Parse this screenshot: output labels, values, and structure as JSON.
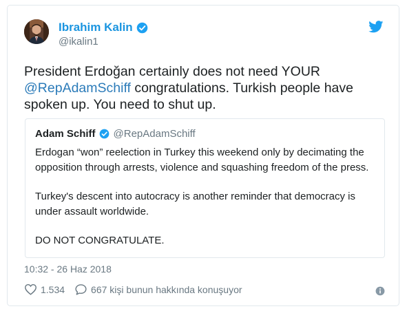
{
  "tweet": {
    "author": {
      "display_name": "Ibrahim Kalin",
      "handle": "@ikalin1",
      "verified": true
    },
    "text": {
      "part1": "President Erdoğan certainly does not need YOUR ",
      "mention": "@RepAdamSchiff",
      "part2": " congratulations. Turkish people have spoken up. You need to shut up."
    },
    "quoted_tweet": {
      "display_name": "Adam Schiff",
      "handle": "@RepAdamSchiff",
      "verified": true,
      "paragraphs": [
        "Erdogan “won” reelection in Turkey this weekend only by decimating the opposition through arrests, violence and squashing freedom of the press.",
        "Turkey's descent into autocracy is another reminder that democracy is under assault worldwide.",
        "DO NOT CONGRATULATE."
      ]
    },
    "timestamp": "10:32 - 26 Haz 2018",
    "likes_count": "1.534",
    "replies_text": "667 kişi bunun hakkında konuşuyor"
  },
  "icons": {
    "brand": "twitter-bird-icon",
    "verified": "verified-badge-icon",
    "like": "heart-icon",
    "reply": "speech-bubble-icon",
    "info": "info-icon"
  },
  "colors": {
    "accent": "#1b95e0",
    "link": "#2b7bb9",
    "secondary_text": "#697882",
    "border": "#e1e8ed"
  }
}
